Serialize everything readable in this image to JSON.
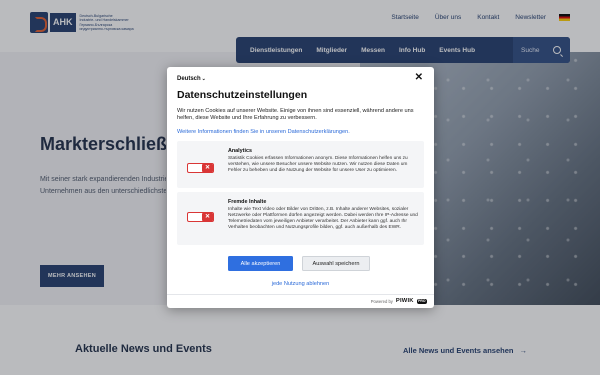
{
  "header": {
    "logo_badge": "AHK",
    "logo_lines": [
      "Deutsch-Bulgarische",
      "Industrie- und Handelskammer",
      "Германо-Българска",
      "индустриално-търговска камара"
    ],
    "top_links": [
      "Startseite",
      "Über uns",
      "Kontakt",
      "Newsletter"
    ],
    "language_flag": "de-flag-icon"
  },
  "main_nav": {
    "items": [
      "Dienstleistungen",
      "Mitglieder",
      "Messen",
      "Info Hub",
      "Events Hub"
    ],
    "search_label": "Suche"
  },
  "hero": {
    "title": "Markterschließung",
    "subtitle_lines": [
      "Mit seiner stark expandierenden Industrie",
      "Unternehmen aus den unterschiedlichsten"
    ],
    "button_label": "MEHR ANSEHEN"
  },
  "news": {
    "title": "Aktuelle News und Events",
    "link_label": "Alle News und Events ansehen",
    "link_arrow": "→"
  },
  "consent": {
    "language": "Deutsch",
    "language_chevron": "⌄",
    "close_symbol": "✕",
    "title": "Datenschutzeinstellungen",
    "intro": "Wir nutzen Cookies auf unserer Website. Einige von ihnen sind essenziell, während andere uns helfen, diese Website und Ihre Erfahrung zu verbessern.",
    "policy_link": "Weitere Informationen finden Sie in unseren Datenschutzerklärungen.",
    "categories": [
      {
        "name": "Analytics",
        "text": "Statistik Cookies erfassen Informationen anonym. Diese Informationen helfen uns zu verstehen, wie unsere Besucher unsere Website nutzen. Wir nutzen diese Daten um Fehler zu beheben und die Nutzung der Website für unsere User zu optimieren.",
        "enabled": false,
        "toggle_symbol": "✕"
      },
      {
        "name": "Fremde Inhalte",
        "text": "Inhalte wie Text Video oder Bilder von Dritten, z.B. Inhalte anderer Websites, sozialer Netzwerke oder Plattformen dürfen angezeigt werden. Dabei werden Ihre IP-Adresse und Telemetriedaten vom jeweiligen Anbieter verarbeitet. Der Anbieter kann ggf. auch Ihr Verhalten beobachten und Nutzungsprofile bilden, ggf. auch außerhalb des EWR.",
        "enabled": false,
        "toggle_symbol": "✕"
      }
    ],
    "accept_all": "Alle akzeptieren",
    "save_selection": "Auswahl speichern",
    "reject_all": "jede Nutzung ablehnen",
    "powered_by": "Powered by",
    "brand": "PIWIK",
    "brand_suffix": "PRO"
  },
  "colors": {
    "brand_navy": "#1f3a6b",
    "accept_blue": "#2f6fe0",
    "toggle_red": "#d93636",
    "link_blue": "#2b6ad8"
  }
}
